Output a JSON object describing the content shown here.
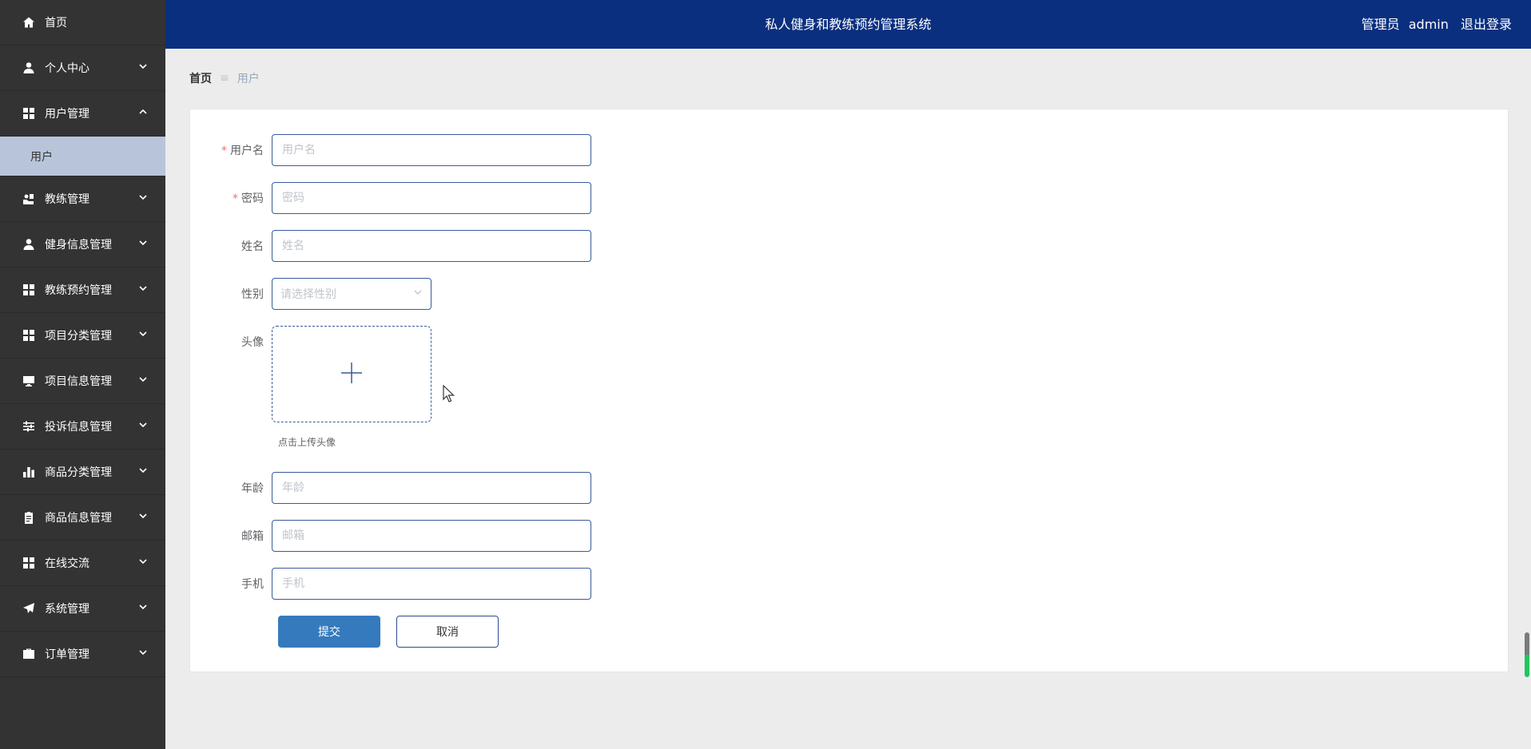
{
  "header": {
    "title": "私人健身和教练预约管理系统",
    "role_label": "管理员",
    "username": "admin",
    "logout_label": "退出登录"
  },
  "sidebar": {
    "items": [
      {
        "label": "首页",
        "icon": "home-icon",
        "expandable": false
      },
      {
        "label": "个人中心",
        "icon": "user-icon",
        "expandable": true
      },
      {
        "label": "用户管理",
        "icon": "grid-icon",
        "expandable": true,
        "expanded": true,
        "sub": [
          {
            "label": "用户"
          }
        ]
      },
      {
        "label": "教练管理",
        "icon": "coach-icon",
        "expandable": true
      },
      {
        "label": "健身信息管理",
        "icon": "user-icon",
        "expandable": true
      },
      {
        "label": "教练预约管理",
        "icon": "grid-icon",
        "expandable": true
      },
      {
        "label": "项目分类管理",
        "icon": "grid-icon",
        "expandable": true
      },
      {
        "label": "项目信息管理",
        "icon": "monitor-icon",
        "expandable": true
      },
      {
        "label": "投诉信息管理",
        "icon": "sliders-icon",
        "expandable": true
      },
      {
        "label": "商品分类管理",
        "icon": "bar-chart-icon",
        "expandable": true
      },
      {
        "label": "商品信息管理",
        "icon": "clipboard-icon",
        "expandable": true
      },
      {
        "label": "在线交流",
        "icon": "grid-icon",
        "expandable": true
      },
      {
        "label": "系统管理",
        "icon": "paper-plane-icon",
        "expandable": true
      },
      {
        "label": "订单管理",
        "icon": "briefcase-icon",
        "expandable": true
      }
    ]
  },
  "breadcrumb": {
    "home": "首页",
    "separator": "≡",
    "current": "用户"
  },
  "form": {
    "username": {
      "label": "用户名",
      "required": true,
      "placeholder": "用户名",
      "value": ""
    },
    "password": {
      "label": "密码",
      "required": true,
      "placeholder": "密码",
      "value": ""
    },
    "name": {
      "label": "姓名",
      "required": false,
      "placeholder": "姓名",
      "value": ""
    },
    "gender": {
      "label": "性别",
      "placeholder": "请选择性别"
    },
    "avatar": {
      "label": "头像",
      "tip": "点击上传头像"
    },
    "age": {
      "label": "年龄",
      "placeholder": "年龄",
      "value": ""
    },
    "email": {
      "label": "邮箱",
      "placeholder": "邮箱",
      "value": ""
    },
    "phone": {
      "label": "手机",
      "placeholder": "手机",
      "value": ""
    },
    "submit_label": "提交",
    "cancel_label": "取消"
  },
  "colors": {
    "header_bg": "#0a2f7f",
    "sidebar_bg": "#333333",
    "sidebar_active_sub_bg": "#b8c4da",
    "primary": "#357abd",
    "required_mark": "#f56c6c"
  }
}
